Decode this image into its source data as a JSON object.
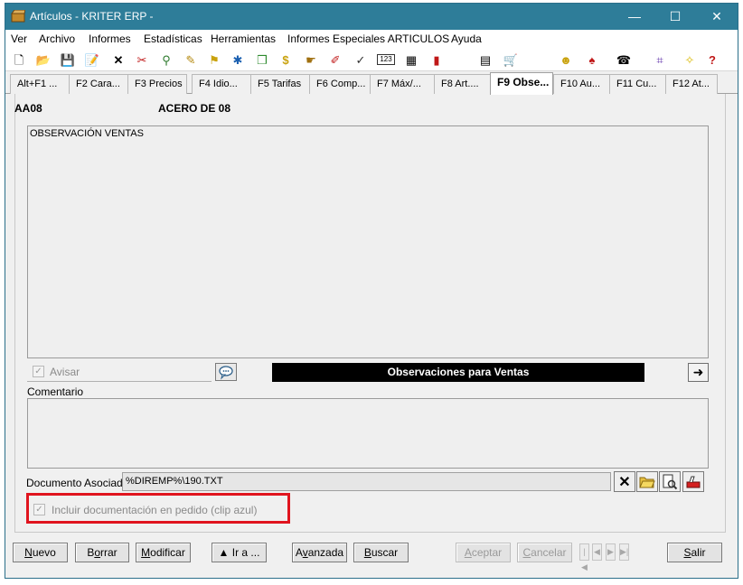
{
  "window": {
    "title": "Artículos - KRITER ERP -",
    "minimize": "—",
    "maximize": "☐",
    "close": "✕"
  },
  "menu": [
    "Ver",
    "Archivo",
    "Informes",
    "Estadísticas",
    "Herramientas",
    "Informes Especiales ARTICULOS",
    "Ayuda"
  ],
  "toolbar": [
    {
      "icon": "new-document-icon",
      "glyph": "🗋"
    },
    {
      "icon": "open-folder-icon",
      "glyph": "📂"
    },
    {
      "icon": "save-icon",
      "glyph": "💾"
    },
    {
      "icon": "edit-icon",
      "glyph": "📝"
    },
    {
      "icon": "delete-icon",
      "glyph": "✕"
    },
    {
      "icon": "tools-icon",
      "glyph": "✂"
    },
    {
      "icon": "filter-icon",
      "glyph": "⚲"
    },
    {
      "icon": "pencil-icon",
      "glyph": "✎"
    },
    {
      "icon": "tree-icon",
      "glyph": "⚑"
    },
    {
      "icon": "network-icon",
      "glyph": "✱"
    },
    {
      "icon": "package-icon",
      "glyph": "❒"
    },
    {
      "icon": "price-icon",
      "glyph": "$"
    },
    {
      "icon": "hand-icon",
      "glyph": "☛"
    },
    {
      "icon": "brush-icon",
      "glyph": "✐"
    },
    {
      "icon": "check-icon",
      "glyph": "✓"
    },
    {
      "icon": "counter-icon",
      "glyph": "123"
    },
    {
      "icon": "calculator-icon",
      "glyph": "▦"
    },
    {
      "icon": "chart-icon",
      "glyph": "▮"
    },
    {
      "icon": "report-icon",
      "glyph": "▤"
    },
    {
      "icon": "cart-icon",
      "glyph": "🛒"
    },
    {
      "icon": "salesman-icon",
      "glyph": "☻"
    },
    {
      "icon": "money-bag-icon",
      "glyph": "♠"
    },
    {
      "icon": "phone-icon",
      "glyph": "☎"
    },
    {
      "icon": "clip-icon",
      "glyph": "⌗"
    },
    {
      "icon": "bulb-icon",
      "glyph": "✧"
    },
    {
      "icon": "help-icon",
      "glyph": "?"
    }
  ],
  "tabs": [
    {
      "label": "Alt+F1 ..."
    },
    {
      "label": "F2 Cara..."
    },
    {
      "label": "F3 Precios"
    },
    {
      "label": "F4 Idio..."
    },
    {
      "label": "F5 Tarifas"
    },
    {
      "label": "F6 Comp..."
    },
    {
      "label": "F7 Máx/..."
    },
    {
      "label": "F8 Art...."
    },
    {
      "label": "F9 Obse..."
    },
    {
      "label": "F10 Au..."
    },
    {
      "label": "F11 Cu..."
    },
    {
      "label": "F12 At..."
    }
  ],
  "article": {
    "code": "AA08",
    "description": "ACERO DE 08"
  },
  "observations": {
    "text": "OBSERVACIÓN VENTAS",
    "avisar_label": "Avisar",
    "bar_label": "Observaciones para Ventas",
    "comentario_label": "Comentario"
  },
  "document": {
    "label": "Documento Asociado",
    "value": "%DIREMP%\\190.TXT",
    "include_label": "Incluir documentación en pedido (clip azul)"
  },
  "buttons": {
    "nuevo": "Nuevo",
    "borrar": "Borrar",
    "modificar": "Modificar",
    "ira": "▲ Ir a ...",
    "avanzada": "Avanzada",
    "buscar": "Buscar",
    "aceptar": "Aceptar",
    "cancelar": "Cancelar",
    "salir": "Salir"
  },
  "colors": {
    "titlebar": "#2e7d99",
    "highlight": "#e0141e"
  }
}
